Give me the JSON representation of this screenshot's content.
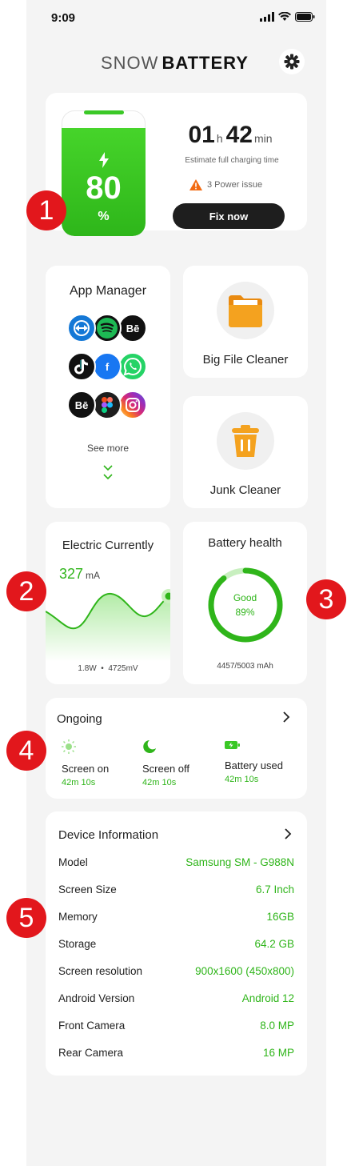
{
  "status": {
    "time": "9:09"
  },
  "brand": {
    "light": "SNOW",
    "bold": "BATTERY"
  },
  "battery": {
    "level": "80",
    "unit": "%",
    "hours": "01",
    "hours_unit": "h",
    "minutes": "42",
    "minutes_unit": "min",
    "estimate_label": "Estimate full charging time",
    "issue": "3 Power issue",
    "fix_label": "Fix now"
  },
  "app_manager": {
    "title": "App Manager",
    "apps": [
      {
        "icon": "teamviewer-icon",
        "color": "#1478d6"
      },
      {
        "icon": "spotify-icon",
        "color": "#1db954"
      },
      {
        "icon": "behance-icon",
        "color": "#111111",
        "text": "Bē"
      },
      {
        "icon": "tiktok-icon",
        "color": "#111111"
      },
      {
        "icon": "facebook-icon",
        "color": "#1877f2",
        "text": "f"
      },
      {
        "icon": "whatsapp-icon",
        "color": "#25d366"
      },
      {
        "icon": "behance-icon",
        "color": "#111111",
        "text": "Bē"
      },
      {
        "icon": "figma-icon",
        "color": "#1e1e1e"
      },
      {
        "icon": "instagram-icon",
        "color": "#d6249f"
      }
    ],
    "see_more": "See more"
  },
  "tools": {
    "big_file": "Big File Cleaner",
    "junk": "Junk Cleaner"
  },
  "electric": {
    "title": "Electric Currently",
    "value": "327",
    "unit": "mA",
    "footer_watts": "1.8W",
    "footer_mv": "4725mV"
  },
  "health": {
    "title": "Battery health",
    "status": "Good",
    "percent": "89%",
    "percent_value": 0.89,
    "capacity": "4457/5003 mAh"
  },
  "ongoing": {
    "title": "Ongoing",
    "items": [
      {
        "label": "Screen on",
        "value": "42m 10s",
        "icon": "sun-icon"
      },
      {
        "label": "Screen off",
        "value": "42m 10s",
        "icon": "moon-icon"
      },
      {
        "label": "Battery used",
        "value": "42m 10s",
        "icon": "battery-charging-icon"
      }
    ]
  },
  "device": {
    "title": "Device Information",
    "rows": [
      {
        "key": "Model",
        "value": "Samsung SM - G988N"
      },
      {
        "key": "Screen Size",
        "value": "6.7 Inch"
      },
      {
        "key": "Memory",
        "value": "16GB"
      },
      {
        "key": "Storage",
        "value": "64.2 GB"
      },
      {
        "key": "Screen resolution",
        "value": "900x1600 (450x800)"
      },
      {
        "key": "Android Version",
        "value": "Android 12"
      },
      {
        "key": "Front Camera",
        "value": "8.0 MP"
      },
      {
        "key": "Rear Camera",
        "value": "16 MP"
      }
    ]
  },
  "markers": [
    "1",
    "2",
    "3",
    "4",
    "5"
  ],
  "colors": {
    "accent": "#2fb51a",
    "marker": "#e2171c",
    "dark_button": "#1e1e1e"
  }
}
